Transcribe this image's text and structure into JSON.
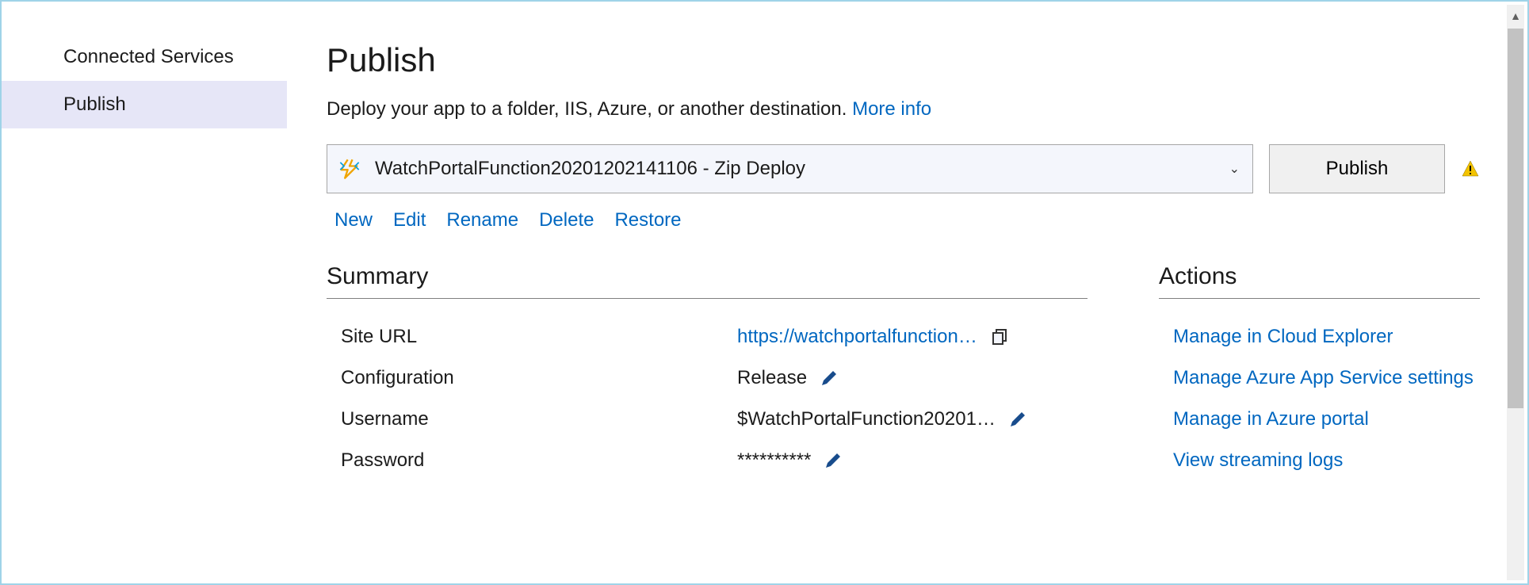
{
  "sidebar": {
    "items": [
      {
        "label": "Connected Services",
        "active": false
      },
      {
        "label": "Publish",
        "active": true
      }
    ]
  },
  "header": {
    "title": "Publish",
    "subtitle_prefix": "Deploy your app to a folder, IIS, Azure, or another destination. ",
    "more_info": "More info"
  },
  "profile": {
    "selected_label": "WatchPortalFunction20201202141106 - Zip Deploy",
    "publish_button": "Publish",
    "links": {
      "new": "New",
      "edit": "Edit",
      "rename": "Rename",
      "delete": "Delete",
      "restore": "Restore"
    }
  },
  "summary": {
    "heading": "Summary",
    "rows": {
      "site_url": {
        "label": "Site URL",
        "value": "https://watchportalfunction…",
        "is_link": true,
        "action_icon": "copy"
      },
      "configuration": {
        "label": "Configuration",
        "value": "Release",
        "is_link": false,
        "action_icon": "edit"
      },
      "username": {
        "label": "Username",
        "value": "$WatchPortalFunction20201…",
        "is_link": false,
        "action_icon": "edit"
      },
      "password": {
        "label": "Password",
        "value": "**********",
        "is_link": false,
        "action_icon": "edit"
      }
    }
  },
  "actions": {
    "heading": "Actions",
    "items": [
      "Manage in Cloud Explorer",
      "Manage Azure App Service settings",
      "Manage in Azure portal",
      "View streaming logs"
    ]
  }
}
